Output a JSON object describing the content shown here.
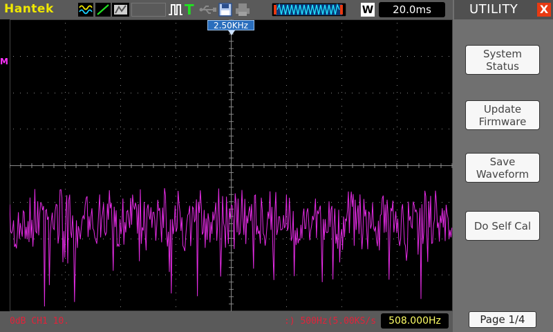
{
  "header": {
    "brand": "Hantek",
    "trigger_letter": "T",
    "wave_letter": "W",
    "timebase": "20.0ms"
  },
  "scope": {
    "center_freq_marker": "2.50KHz",
    "channel_marker": "M"
  },
  "footer": {
    "left_info": "0dB  CH1  10.",
    "right_info": ":)  500Hz(5.00KS/s",
    "cursor_freq": "508.000Hz"
  },
  "panel": {
    "title": "UTILITY",
    "close_label": "X",
    "buttons": [
      {
        "label": "System\nStatus"
      },
      {
        "label": "Update\nFirmware"
      },
      {
        "label": "Save\nWaveform"
      },
      {
        "label": "Do Self Cal"
      }
    ],
    "page": "Page 1/4"
  },
  "colors": {
    "trace": "#e62ce6",
    "brand": "#f0e800",
    "grid": "#8a8a8a",
    "panel": "#707070",
    "marker": "#2a6ebd"
  },
  "icons": [
    "waveform-icon",
    "ramp-icon",
    "display-mode-icon",
    "pulse-trigger-icon",
    "usb-icon",
    "save-icon",
    "printer-icon",
    "memory-depth-icon"
  ]
}
